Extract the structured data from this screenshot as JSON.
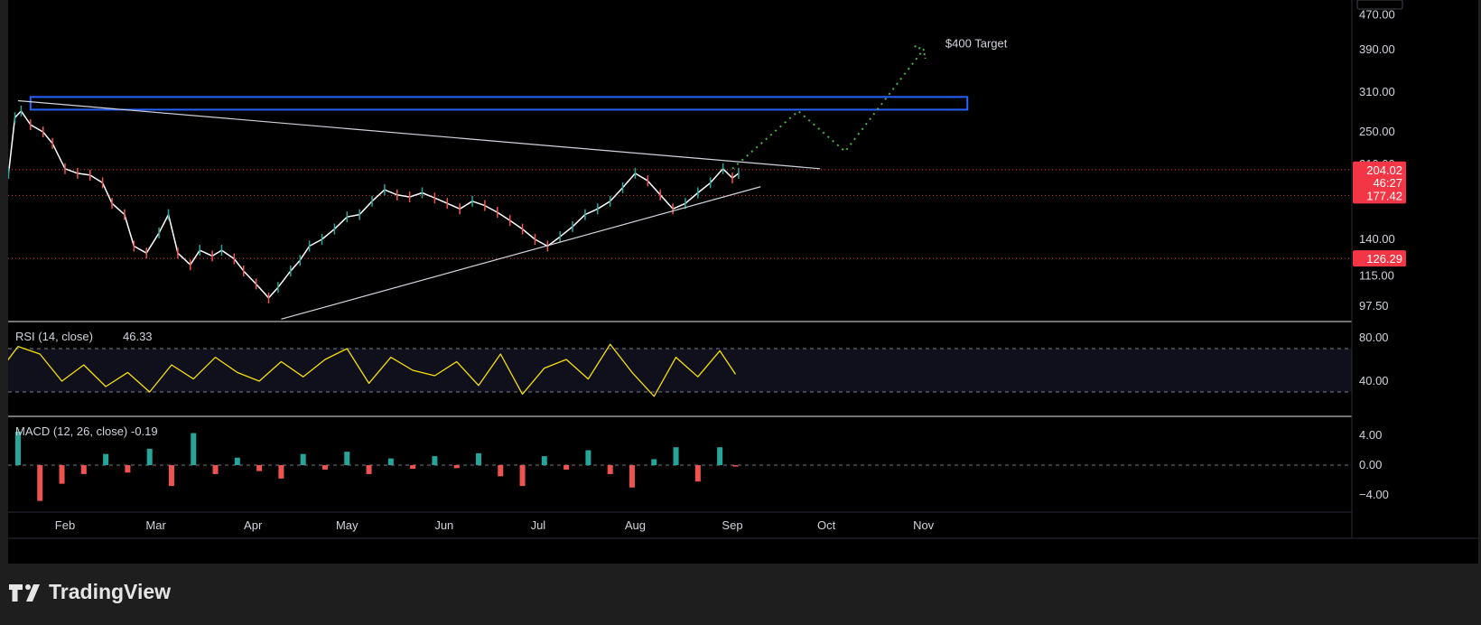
{
  "colors": {
    "background": "#000000",
    "up": "#26a69a",
    "down": "#ef5350",
    "candle_body": "#ffffff",
    "rsi_line": "#f5e00a",
    "macd_up": "#26a69a",
    "macd_down": "#ef5350",
    "projection": "#4caf50",
    "zone_border": "#2962ff",
    "price_tag": "#f23645",
    "level_line": "#f23645",
    "trendline": "#d1d4dc"
  },
  "chart_data": [
    {
      "type": "line",
      "name": "price",
      "y_scale": "log",
      "ylim": [
        90,
        480
      ],
      "y_ticks": [
        470,
        390,
        310,
        250,
        140,
        115,
        97.5
      ],
      "y_tick_labels": [
        "470.00",
        "390.00",
        "310.00",
        "250.00",
        "140.00",
        "115.00",
        "97.50"
      ],
      "x_labels": [
        "Feb",
        "Mar",
        "Apr",
        "May",
        "Jun",
        "Jul",
        "Aug",
        "Sep",
        "Oct",
        "Nov"
      ],
      "x_label_dates": [
        "2024-02-01",
        "2024-03-01",
        "2024-04-01",
        "2024-05-01",
        "2024-06-01",
        "2024-07-01",
        "2024-08-01",
        "2024-09-01",
        "2024-10-01",
        "2024-11-01"
      ],
      "series": [
        {
          "x": [
            "2024-01-10",
            "2024-01-14",
            "2024-01-16",
            "2024-01-18",
            "2024-01-21",
            "2024-01-25",
            "2024-01-28",
            "2024-02-01",
            "2024-02-05",
            "2024-02-09",
            "2024-02-13",
            "2024-02-16",
            "2024-02-20",
            "2024-02-23",
            "2024-02-27",
            "2024-03-02",
            "2024-03-05",
            "2024-03-08",
            "2024-03-12",
            "2024-03-15",
            "2024-03-19",
            "2024-03-22",
            "2024-03-26",
            "2024-03-29",
            "2024-04-02",
            "2024-04-06",
            "2024-04-09",
            "2024-04-13",
            "2024-04-16",
            "2024-04-19",
            "2024-04-23",
            "2024-04-27",
            "2024-05-01",
            "2024-05-05",
            "2024-05-09",
            "2024-05-13",
            "2024-05-17",
            "2024-05-21",
            "2024-05-25",
            "2024-05-29",
            "2024-06-02",
            "2024-06-06",
            "2024-06-10",
            "2024-06-14",
            "2024-06-18",
            "2024-06-22",
            "2024-06-26",
            "2024-06-30",
            "2024-07-04",
            "2024-07-08",
            "2024-07-12",
            "2024-07-16",
            "2024-07-20",
            "2024-07-24",
            "2024-07-28",
            "2024-08-01",
            "2024-08-05",
            "2024-08-09",
            "2024-08-13",
            "2024-08-17",
            "2024-08-21",
            "2024-08-25",
            "2024-08-29",
            "2024-09-01",
            "2024-09-03"
          ],
          "y": [
            190,
            200,
            270,
            280,
            260,
            250,
            235,
            205,
            200,
            198,
            190,
            170,
            160,
            135,
            130,
            145,
            160,
            130,
            122,
            132,
            128,
            132,
            126,
            118,
            110,
            102,
            108,
            118,
            125,
            135,
            140,
            148,
            158,
            160,
            172,
            183,
            178,
            176,
            180,
            175,
            170,
            165,
            172,
            168,
            162,
            155,
            148,
            140,
            135,
            142,
            150,
            160,
            165,
            172,
            185,
            200,
            192,
            178,
            165,
            170,
            180,
            190,
            205,
            195,
            200
          ]
        }
      ],
      "levels": [
        204.02,
        177.42,
        126.29
      ],
      "price_tags": [
        {
          "value": 204.02,
          "label": "204.02",
          "sub_label": "46:27"
        },
        {
          "value": 177.42,
          "label": "177.42"
        },
        {
          "value": 126.29,
          "label": "126.29"
        }
      ],
      "partial_tick_label": "210.00",
      "resistance_zone": {
        "x_start": "2024-01-21",
        "x_end": "2024-11-15",
        "y_low": 282,
        "y_high": 302
      },
      "trendlines": [
        {
          "x": [
            "2024-01-17",
            "2024-09-29"
          ],
          "y": [
            296,
            205
          ]
        },
        {
          "x": [
            "2024-04-10",
            "2024-09-10"
          ],
          "y": [
            91,
            186
          ]
        }
      ],
      "projection": {
        "x": [
          "2024-09-01",
          "2024-09-22",
          "2024-10-07",
          "2024-11-01"
        ],
        "y": [
          205,
          280,
          225,
          390
        ]
      },
      "annotations": [
        {
          "text": "$400 Target",
          "x": "2024-11-08",
          "y": 395
        }
      ]
    },
    {
      "type": "line",
      "name": "rsi",
      "legend_label": "RSI (14, close)",
      "legend_value": "46.33",
      "ylim": [
        10,
        100
      ],
      "y_ticks": [
        80,
        40
      ],
      "y_tick_labels": [
        "80.00",
        "40.00"
      ],
      "bands": [
        70,
        30
      ],
      "x": [
        "2024-01-10",
        "2024-01-17",
        "2024-01-24",
        "2024-01-31",
        "2024-02-07",
        "2024-02-14",
        "2024-02-21",
        "2024-02-28",
        "2024-03-06",
        "2024-03-13",
        "2024-03-20",
        "2024-03-27",
        "2024-04-03",
        "2024-04-10",
        "2024-04-17",
        "2024-04-24",
        "2024-05-01",
        "2024-05-08",
        "2024-05-15",
        "2024-05-22",
        "2024-05-29",
        "2024-06-05",
        "2024-06-12",
        "2024-06-19",
        "2024-06-26",
        "2024-07-03",
        "2024-07-10",
        "2024-07-17",
        "2024-07-24",
        "2024-07-31",
        "2024-08-07",
        "2024-08-14",
        "2024-08-21",
        "2024-08-28",
        "2024-09-02"
      ],
      "y": [
        45,
        72,
        65,
        40,
        55,
        35,
        48,
        30,
        55,
        42,
        62,
        48,
        40,
        58,
        44,
        60,
        70,
        38,
        62,
        50,
        45,
        58,
        36,
        65,
        28,
        52,
        60,
        42,
        74,
        48,
        26,
        62,
        44,
        68,
        46.33
      ]
    },
    {
      "type": "bar",
      "name": "macd",
      "legend_label": "MACD (12, 26, close)",
      "legend_value": "-0.19",
      "ylim": [
        -6,
        6
      ],
      "y_ticks": [
        4,
        0,
        -4
      ],
      "y_tick_labels": [
        "4.00",
        "0.00",
        "−4.00"
      ],
      "x": [
        "2024-01-10",
        "2024-01-17",
        "2024-01-24",
        "2024-01-31",
        "2024-02-07",
        "2024-02-14",
        "2024-02-21",
        "2024-02-28",
        "2024-03-06",
        "2024-03-13",
        "2024-03-20",
        "2024-03-27",
        "2024-04-03",
        "2024-04-10",
        "2024-04-17",
        "2024-04-24",
        "2024-05-01",
        "2024-05-08",
        "2024-05-15",
        "2024-05-22",
        "2024-05-29",
        "2024-06-05",
        "2024-06-12",
        "2024-06-19",
        "2024-06-26",
        "2024-07-03",
        "2024-07-10",
        "2024-07-17",
        "2024-07-24",
        "2024-07-31",
        "2024-08-07",
        "2024-08-14",
        "2024-08-21",
        "2024-08-28",
        "2024-09-02"
      ],
      "y": [
        1.2,
        4.5,
        -4.8,
        -2.5,
        -1.2,
        1.5,
        -1.0,
        2.2,
        -2.8,
        4.3,
        -1.2,
        1.0,
        -0.8,
        -1.8,
        1.5,
        -0.6,
        1.8,
        -1.2,
        0.9,
        -0.5,
        1.2,
        -0.4,
        1.6,
        -1.5,
        -2.8,
        1.2,
        -0.6,
        2.0,
        -1.2,
        -3.0,
        0.8,
        2.4,
        -2.2,
        2.4,
        -0.19
      ]
    }
  ],
  "footer": {
    "brand": "TradingView"
  }
}
